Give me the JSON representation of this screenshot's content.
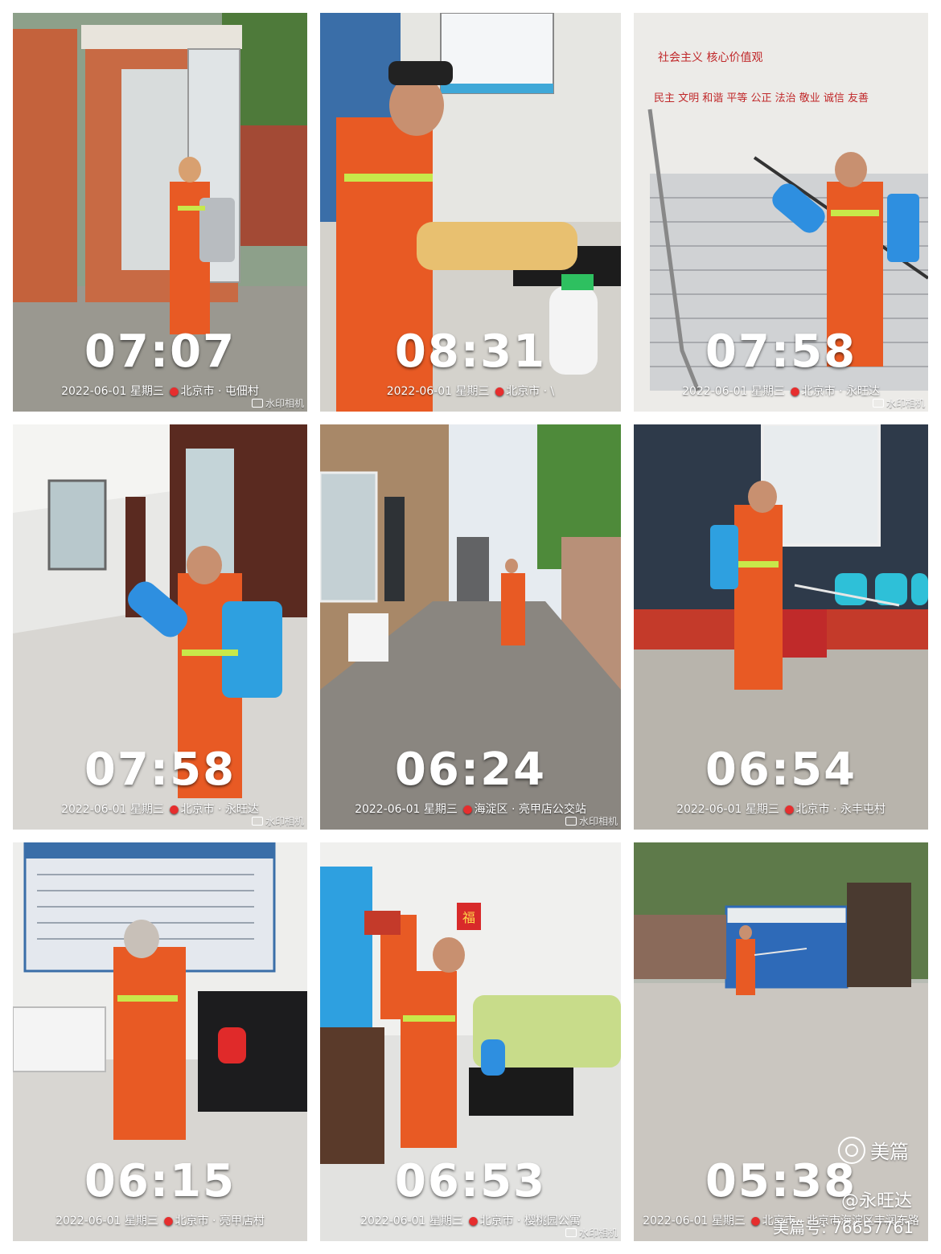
{
  "photos": [
    {
      "time": "07:07",
      "date": "2022-06-01",
      "weekday": "星期三",
      "location": "北京市 · 屯佃村",
      "watermark": "水印相机"
    },
    {
      "time": "08:31",
      "date": "2022-06-01",
      "weekday": "星期三",
      "location": "北京市 · \\",
      "watermark": ""
    },
    {
      "time": "07:58",
      "date": "2022-06-01",
      "weekday": "星期三",
      "location": "北京市 · 永旺达",
      "watermark": "水印相机"
    },
    {
      "time": "07:58",
      "date": "2022-06-01",
      "weekday": "星期三",
      "location": "北京市 · 永旺达",
      "watermark": "水印相机"
    },
    {
      "time": "06:24",
      "date": "2022-06-01",
      "weekday": "星期三",
      "location": "海淀区 · 亮甲店公交站",
      "watermark": "水印相机"
    },
    {
      "time": "06:54",
      "date": "2022-06-01",
      "weekday": "星期三",
      "location": "北京市 · 永丰屯村",
      "watermark": ""
    },
    {
      "time": "06:15",
      "date": "2022-06-01",
      "weekday": "星期三",
      "location": "北京市 · 亮甲店村",
      "watermark": ""
    },
    {
      "time": "06:53",
      "date": "2022-06-01",
      "weekday": "星期三",
      "location": "北京市 · 樱桃园公寓",
      "watermark": "水印相机"
    },
    {
      "time": "05:38",
      "date": "2022-06-01",
      "weekday": "星期三",
      "location": "北京市 · 北京市海淀区丰润东路",
      "watermark": ""
    }
  ],
  "signs": {
    "values_wall": "民主 文明 和谐 平等 公正 法治 敬业 诚信 友善",
    "red_sign": "社会主义 核心价值观",
    "fu": "福"
  },
  "meipian": {
    "logo": "美篇",
    "user": "@永旺达",
    "number": "美篇号: 76657761"
  },
  "colors": {
    "uniform": "#e85a24",
    "reflective": "#c8e84a",
    "pin": "#e62e2e"
  }
}
